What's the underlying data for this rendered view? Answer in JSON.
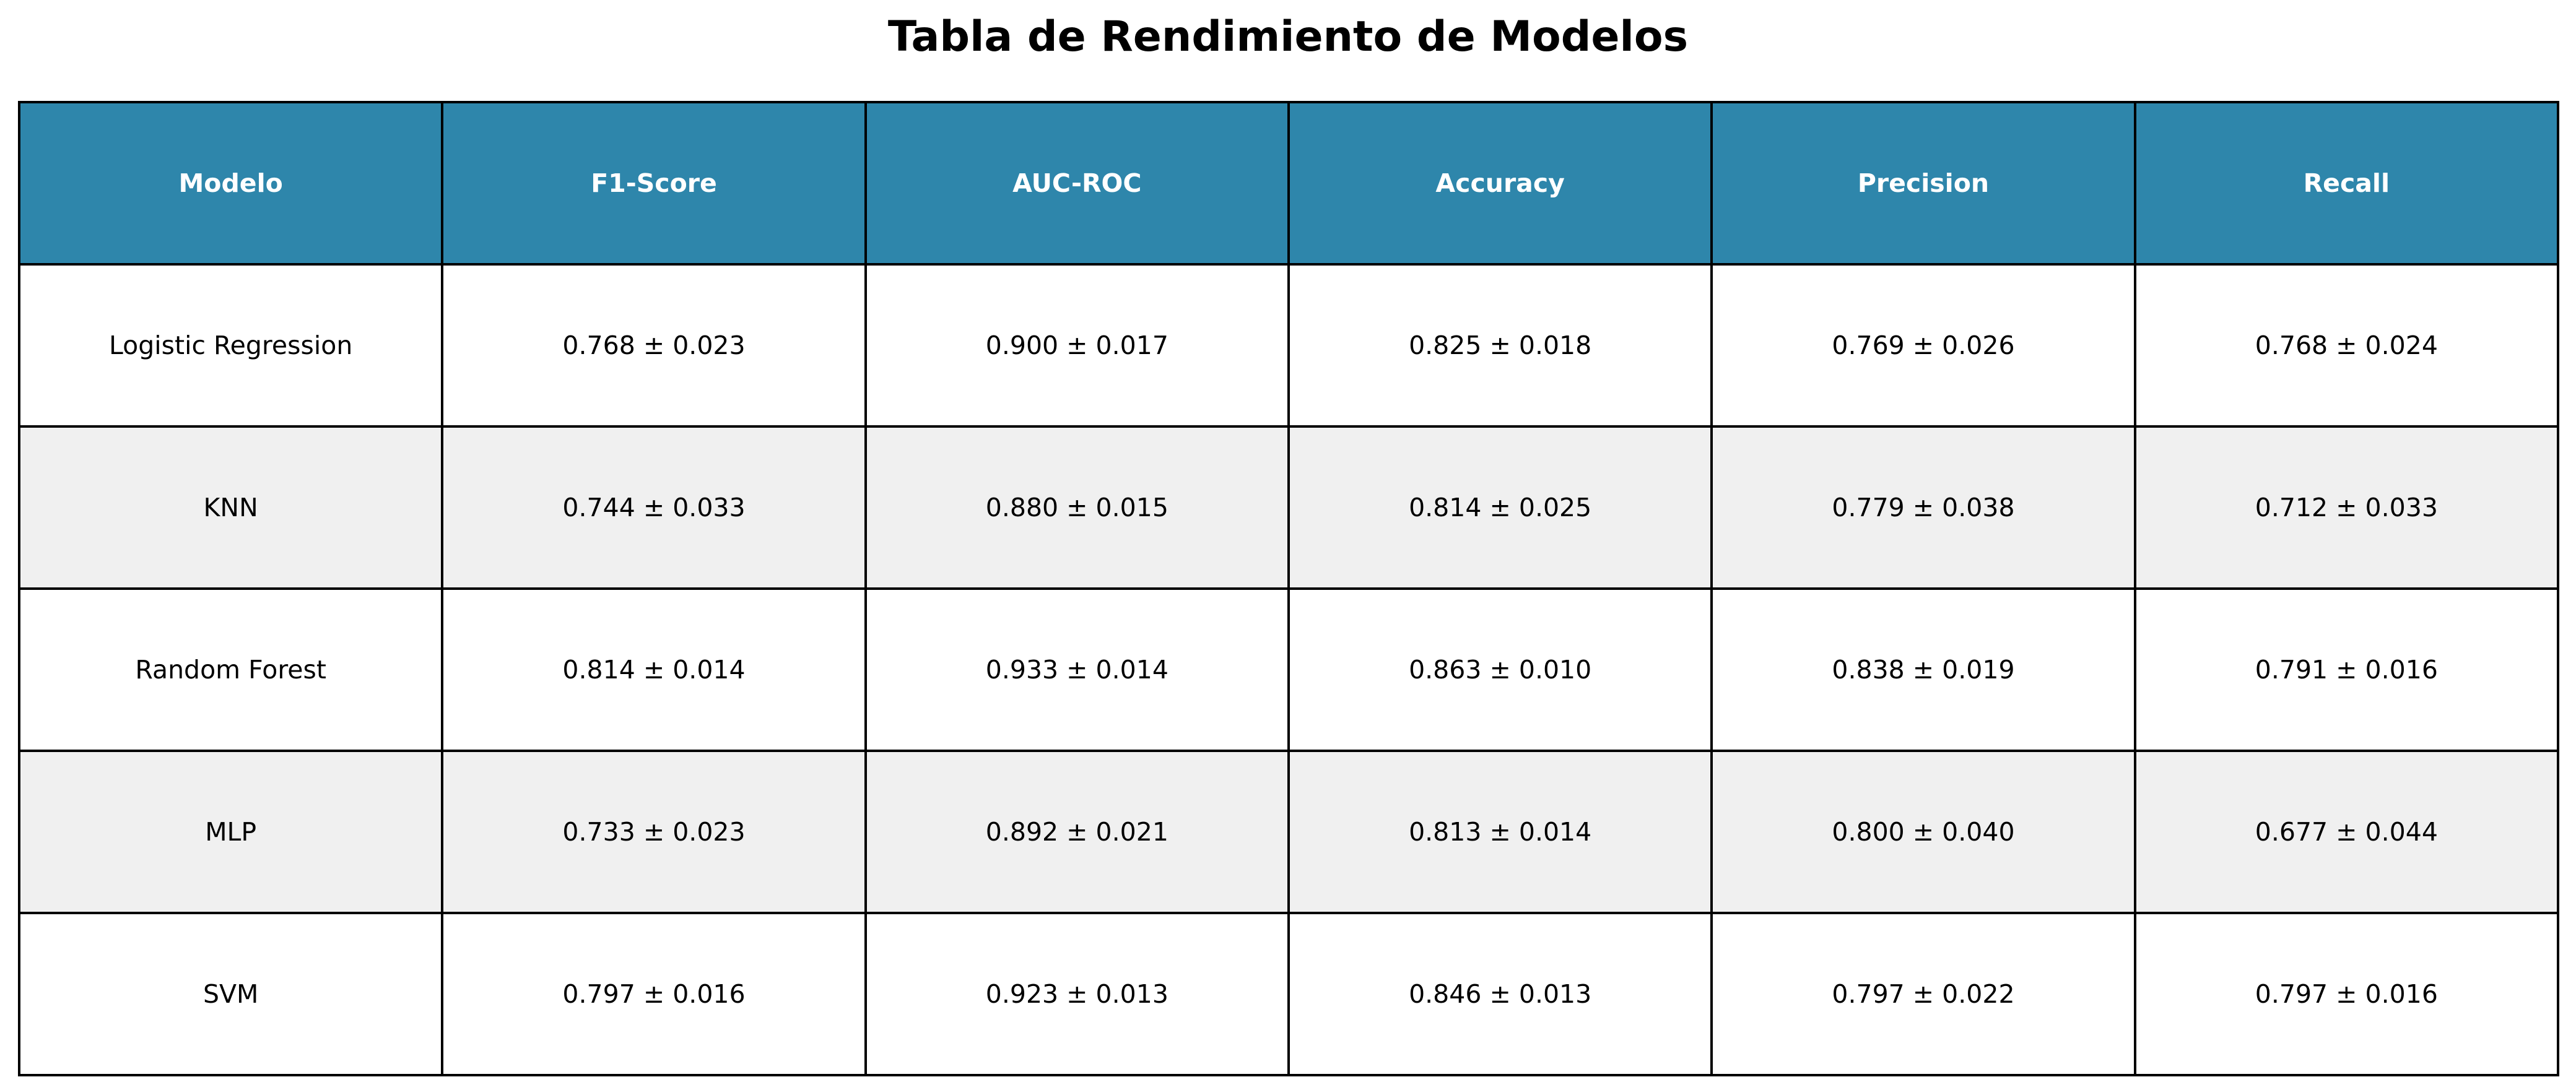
{
  "chart_data": {
    "type": "table",
    "title": "Tabla de Rendimiento de Modelos",
    "columns": [
      "Modelo",
      "F1-Score",
      "AUC-ROC",
      "Accuracy",
      "Precision",
      "Recall"
    ],
    "rows": [
      [
        "Logistic Regression",
        "0.768 ± 0.023",
        "0.900 ± 0.017",
        "0.825 ± 0.018",
        "0.769 ± 0.026",
        "0.768 ± 0.024"
      ],
      [
        "KNN",
        "0.744 ± 0.033",
        "0.880 ± 0.015",
        "0.814 ± 0.025",
        "0.779 ± 0.038",
        "0.712 ± 0.033"
      ],
      [
        "Random Forest",
        "0.814 ± 0.014",
        "0.933 ± 0.014",
        "0.863 ± 0.010",
        "0.838 ± 0.019",
        "0.791 ± 0.016"
      ],
      [
        "MLP",
        "0.733 ± 0.023",
        "0.892 ± 0.021",
        "0.813 ± 0.014",
        "0.800 ± 0.040",
        "0.677 ± 0.044"
      ],
      [
        "SVM",
        "0.797 ± 0.016",
        "0.923 ± 0.013",
        "0.846 ± 0.013",
        "0.797 ± 0.022",
        "0.797 ± 0.016"
      ]
    ],
    "colors": {
      "header_bg": "#2e86ab",
      "header_text": "#ffffff",
      "row_alt_bg": "#f0f0f0",
      "row_bg": "#ffffff",
      "border": "#000000"
    }
  }
}
